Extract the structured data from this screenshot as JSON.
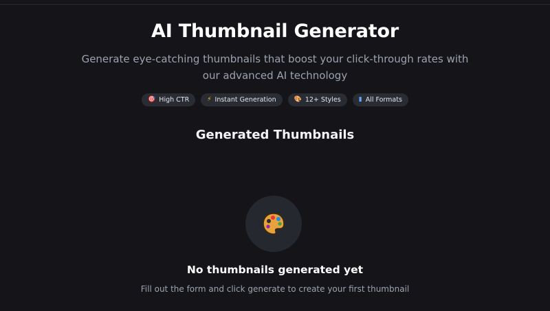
{
  "header": {
    "title": "AI Thumbnail Generator",
    "subtitle": "Generate eye-catching thumbnails that boost your click-through rates with our advanced AI technology"
  },
  "badges": [
    {
      "icon": "target-icon",
      "glyph": "🎯",
      "label": "High CTR"
    },
    {
      "icon": "lightning-icon",
      "glyph": "⚡",
      "label": "Instant Generation"
    },
    {
      "icon": "palette-icon",
      "glyph": "🎨",
      "label": "12+ Styles"
    },
    {
      "icon": "phone-icon",
      "glyph": "▮",
      "label": "All Formats"
    }
  ],
  "results": {
    "section_title": "Generated Thumbnails",
    "empty_icon": "palette-icon",
    "empty_title": "No thumbnails generated yet",
    "empty_description": "Fill out the form and click generate to create your first thumbnail"
  },
  "colors": {
    "background": "#141419",
    "badge_bg": "#2a2c33",
    "empty_circle_bg": "#26282f",
    "muted_text": "#9ca3af"
  }
}
